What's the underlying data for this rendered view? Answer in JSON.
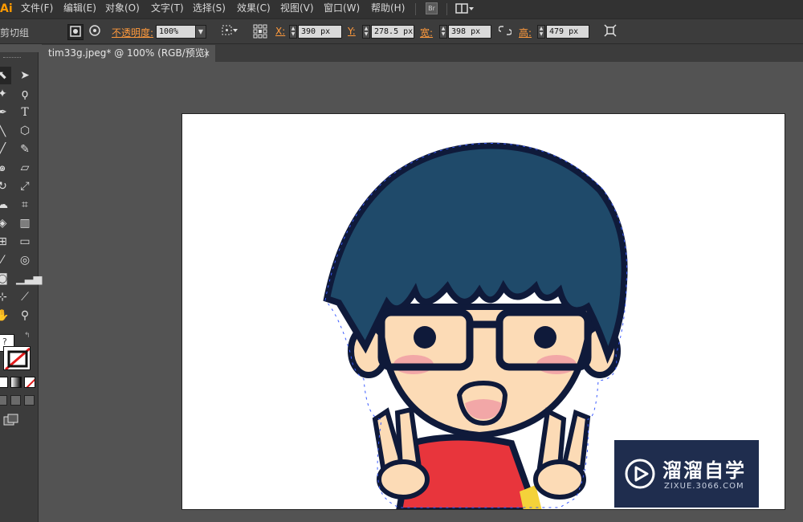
{
  "menubar": {
    "logo": "Ai",
    "items": [
      "文件(F)",
      "编辑(E)",
      "对象(O)",
      "文字(T)",
      "选择(S)",
      "效果(C)",
      "视图(V)",
      "窗口(W)",
      "帮助(H)"
    ],
    "bridge_label": "Br"
  },
  "control": {
    "selection_label": "剪切组",
    "opacity_label": "不透明度:",
    "opacity_value": "100%",
    "x_label": "X:",
    "x_value": "390 px",
    "y_label": "Y:",
    "y_value": "278.5 px",
    "w_label": "宽:",
    "w_value": "398 px",
    "h_label": "高:",
    "h_value": "479 px"
  },
  "document_tab": {
    "title": "tim33g.jpeg* @ 100% (RGB/预览)",
    "close": "×"
  },
  "tools_panel": {
    "fill_none_hint": "?"
  },
  "watermark": {
    "brand": "溜溜自学",
    "url": "ZIXUE.3066.COM"
  },
  "colors": {
    "hair": "#1f4a6a",
    "outline": "#0f1a3a",
    "skin": "#fcdbb6",
    "shirt": "#e8353c",
    "blush": "#f2a7a7",
    "selection": "#3b5bff",
    "watermark_bg": "#1f2d4e"
  }
}
